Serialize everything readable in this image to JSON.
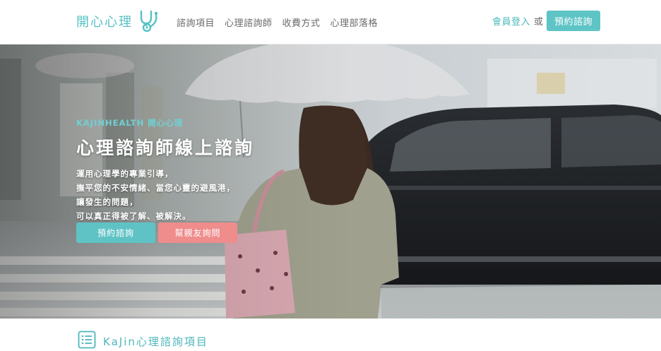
{
  "header": {
    "logo_text": "開心心理",
    "nav": [
      {
        "label": "諮詢項目"
      },
      {
        "label": "心理諮詢師"
      },
      {
        "label": "收費方式"
      },
      {
        "label": "心理部落格"
      }
    ],
    "login_label": "會員登入",
    "or_label": "或",
    "book_label": "預約諮詢"
  },
  "hero": {
    "eyebrow": "KAJINHEALTH 開心心理",
    "title": "心理諮詢師線上諮詢",
    "lines": [
      "運用心理學的專業引導，",
      "撫平您的不安情緒、當您心靈的避風港，",
      "讓發生的問題，",
      "可以真正得被了解、被解決。"
    ],
    "primary_button": "預約諮詢",
    "secondary_button": "幫親友詢問"
  },
  "section": {
    "title": "KaJin心理諮詢項目"
  },
  "colors": {
    "accent": "#5ec4c6",
    "secondary": "#ef8c8c"
  }
}
